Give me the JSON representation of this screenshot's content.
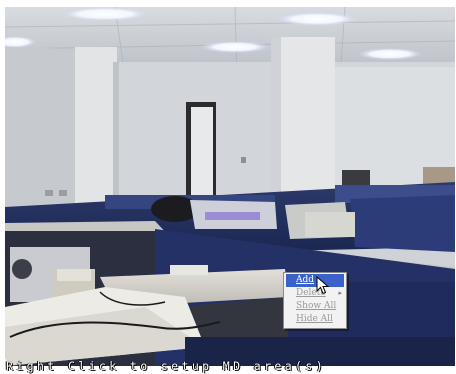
{
  "context_menu": {
    "items": [
      {
        "label": "Add",
        "state": "selected"
      },
      {
        "label": "Delete",
        "state": "disabled",
        "has_submenu": true
      },
      {
        "label": "Show All",
        "state": "disabled"
      },
      {
        "label": "Hide All",
        "state": "disabled"
      }
    ]
  },
  "overlay": {
    "instruction": "Right Click to setup MD area(s)"
  },
  "colors": {
    "menu_highlight": "#3a62c8",
    "menu_background": "#f2f2f2",
    "disabled_text": "#9a9a9a",
    "overlay_text": "#ffffff"
  },
  "icons": {
    "cursor": "arrow-pointer-icon",
    "submenu": "chevron-right-icon"
  }
}
